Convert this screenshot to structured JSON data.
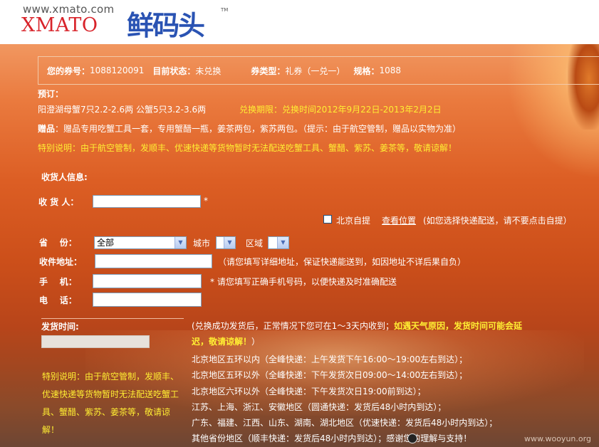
{
  "header": {
    "url_text": "www.xmato.com",
    "brand_en": "XMATO",
    "brand_cn": "鲜码头",
    "trademark": "TM"
  },
  "voucher": {
    "number_label": "您的券号：",
    "number_value": "1088120091",
    "status_label": "目前状态：",
    "status_value": "未兑换",
    "type_label": "券类型：",
    "type_value": "礼券（一兑一）",
    "spec_label": "规格：",
    "spec_value": "1088"
  },
  "order": {
    "title": "预订：",
    "product": "阳澄湖母蟹7只2.2-2.6两 公蟹5只3.2-3.6两",
    "period": "兑换期限：兑换时间2012年9月22日-2013年2月2日",
    "gift_label": "赠品",
    "gift_text": "：赠品专用吃蟹工具一套，专用蟹醋一瓶，姜茶两包，紫苏两包。（提示：由于航空管制，赠品以实物为准）",
    "special_note": "特别说明：由于航空管制，发顺丰、优速快递等货物暂时无法配送吃蟹工具、蟹醋、紫苏、姜茶等，敬请谅解！"
  },
  "form": {
    "section_title": "收货人信息:",
    "recipient_label": "收 货 人：",
    "recipient_value": "",
    "required_mark": "*",
    "pickup_label": "北京自提",
    "view_location": "查看位置",
    "pickup_hint": "(如您选择快递配送，请不要点击自提）",
    "province_label": "省    份：",
    "province_value": "全部",
    "city_label": "城市",
    "district_label": "区域",
    "address_label": "收件地址：",
    "address_value": "",
    "address_hint": "（请您填写详细地址，保证快递能送到，如因地址不详后果自负）",
    "mobile_label": "手    机：",
    "mobile_value": "",
    "mobile_hint": "* 请您填写正确手机号码，以便快递及时准确配送",
    "phone_label": "电    话：",
    "phone_value": ""
  },
  "shipping": {
    "title": "发货时间:",
    "time_value": "",
    "notice_normal": "(兑换成功发货后，正常情况下您可在1～3天内收到；",
    "notice_bold_1": "如遇天气原因，发货时间可能会延",
    "notice_bold_2": "迟，敬请谅解！",
    "notice_end": "）",
    "rules": [
      "北京地区五环以内（全峰快递：上午发货下午16:00～19:00左右到达）；",
      "北京地区五环以外（全峰快递：下午发货次日09:00～14:00左右到达）；",
      "北京地区六环以外（全峰快递：下午发货次日19:00前到达）；",
      "江苏、上海、浙江、安徽地区（圆通快递：发货后48小时内到达）；",
      "广东、福建、江西、山东、湖南、湖北地区（优速快递：发货后48小时内到达）；",
      "其他省份地区（顺丰快递：发货后48小时内到达）；感谢您的理解与支持！"
    ],
    "special_note": "特别说明：由于航空管制，发顺丰、优速快递等货物暂时无法配送吃蟹工具、蟹醋、紫苏、姜茶等，敬请谅解！"
  },
  "watermark": "www.wooyun.org",
  "colors": {
    "highlight": "#ffee33",
    "brand_red": "#d8232a",
    "brand_blue": "#2a53b3"
  }
}
